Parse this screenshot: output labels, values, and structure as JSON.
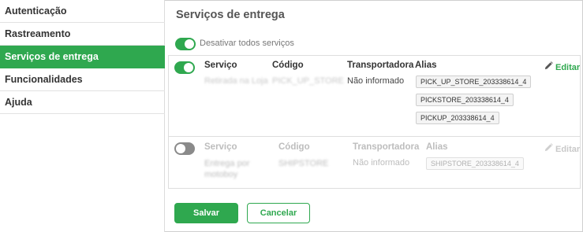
{
  "sidebar": {
    "items": [
      {
        "label": "Autenticação",
        "active": false
      },
      {
        "label": "Rastreamento",
        "active": false
      },
      {
        "label": "Serviços de entrega",
        "active": true
      },
      {
        "label": "Funcionalidades",
        "active": false
      },
      {
        "label": "Ajuda",
        "active": false
      }
    ]
  },
  "main": {
    "title": "Serviços de entrega",
    "master_toggle": {
      "label": "Desativar todos serviços",
      "on": true
    },
    "columns": {
      "service": "Serviço",
      "code": "Código",
      "carrier": "Transportadora",
      "alias": "Alias"
    },
    "services": [
      {
        "enabled": true,
        "name": "Retirada na Loja",
        "code": "PICK_UP_STORE",
        "carrier": "Não informado",
        "aliases": [
          "PICK_UP_STORE_203338614_4",
          "PICKSTORE_203338614_4",
          "PICKUP_203338614_4"
        ],
        "edit_label": "Editar"
      },
      {
        "enabled": false,
        "name_line1": "Entrega por",
        "name_line2": "motoboy",
        "code": "SHIPSTORE",
        "carrier": "Não informado",
        "aliases": [
          "SHIPSTORE_203338614_4"
        ],
        "edit_label": "Editar"
      }
    ]
  },
  "actions": {
    "save_label": "Salvar",
    "cancel_label": "Cancelar"
  },
  "colors": {
    "accent": "#2fa84f",
    "toggle_off": "#8a8a8a"
  }
}
